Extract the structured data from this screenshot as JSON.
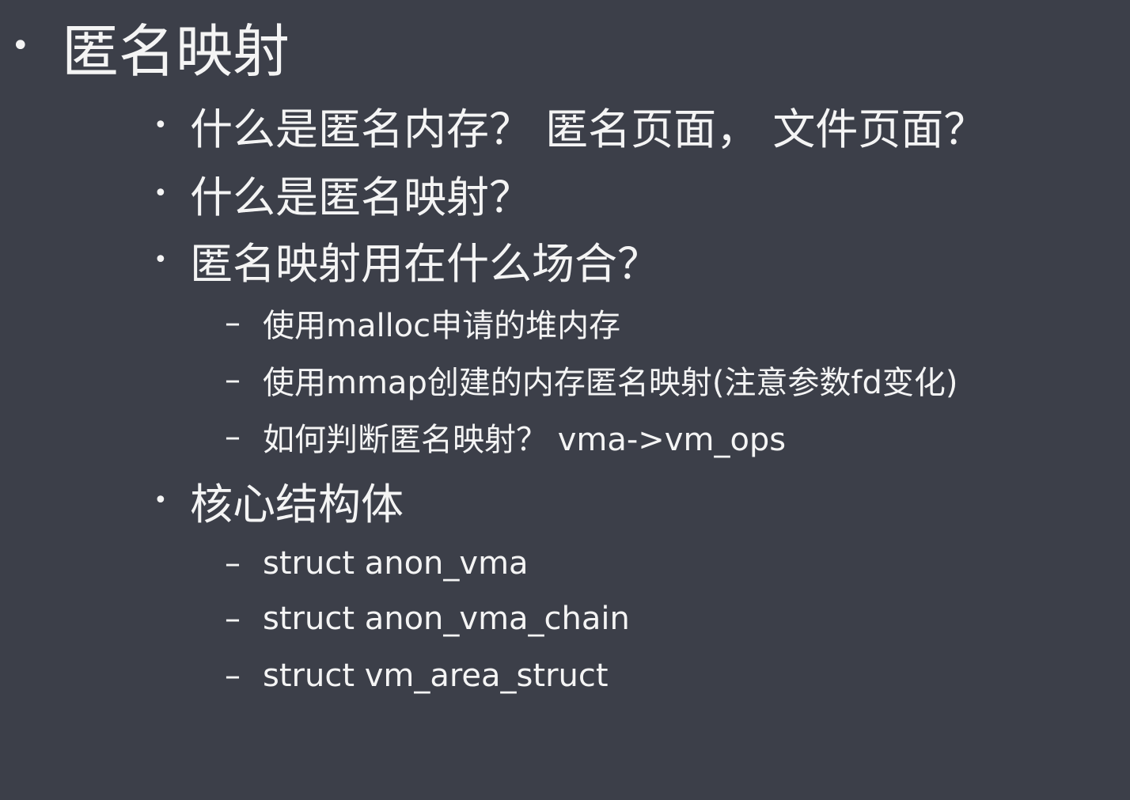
{
  "title": "匿名映射",
  "items": [
    {
      "text": "什么是匿名内存？ 匿名页面， 文件页面？"
    },
    {
      "text": "什么是匿名映射？"
    },
    {
      "text": "匿名映射用在什么场合？",
      "subitems": [
        "使用malloc申请的堆内存",
        "使用mmap创建的内存匿名映射(注意参数fd变化)",
        "如何判断匿名映射？ vma->vm_ops"
      ]
    },
    {
      "text": "核心结构体",
      "subitems": [
        "struct anon_vma",
        "struct anon_vma_chain",
        "struct vm_area_struct"
      ]
    }
  ],
  "bullet_glyph": "•",
  "dash_glyph": "–",
  "colors": {
    "background": "#3c3f49",
    "text": "#f4f4f4"
  }
}
